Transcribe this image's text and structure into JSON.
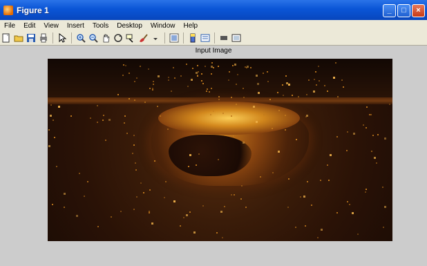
{
  "window": {
    "title": "Figure 1",
    "buttons": {
      "minimize": "_",
      "maximize": "□",
      "close": "×"
    }
  },
  "menubar": {
    "items": [
      "File",
      "Edit",
      "View",
      "Insert",
      "Tools",
      "Desktop",
      "Window",
      "Help"
    ]
  },
  "toolbar": {
    "icons": [
      "new-figure-icon",
      "open-file-icon",
      "save-icon",
      "print-icon",
      "edit-plot-icon",
      "zoom-in-icon",
      "zoom-out-icon",
      "pan-icon",
      "rotate-3d-icon",
      "data-cursor-icon",
      "brush-icon",
      "link-plot-icon",
      "colorbar-icon",
      "legend-icon",
      "hide-plot-tools-icon",
      "show-plot-tools-icon"
    ]
  },
  "axes": {
    "title": "Input Image"
  },
  "colors": {
    "titlebar": "#0a55d6",
    "menubar_bg": "#ece9d8",
    "figure_bg": "#cccccc"
  }
}
